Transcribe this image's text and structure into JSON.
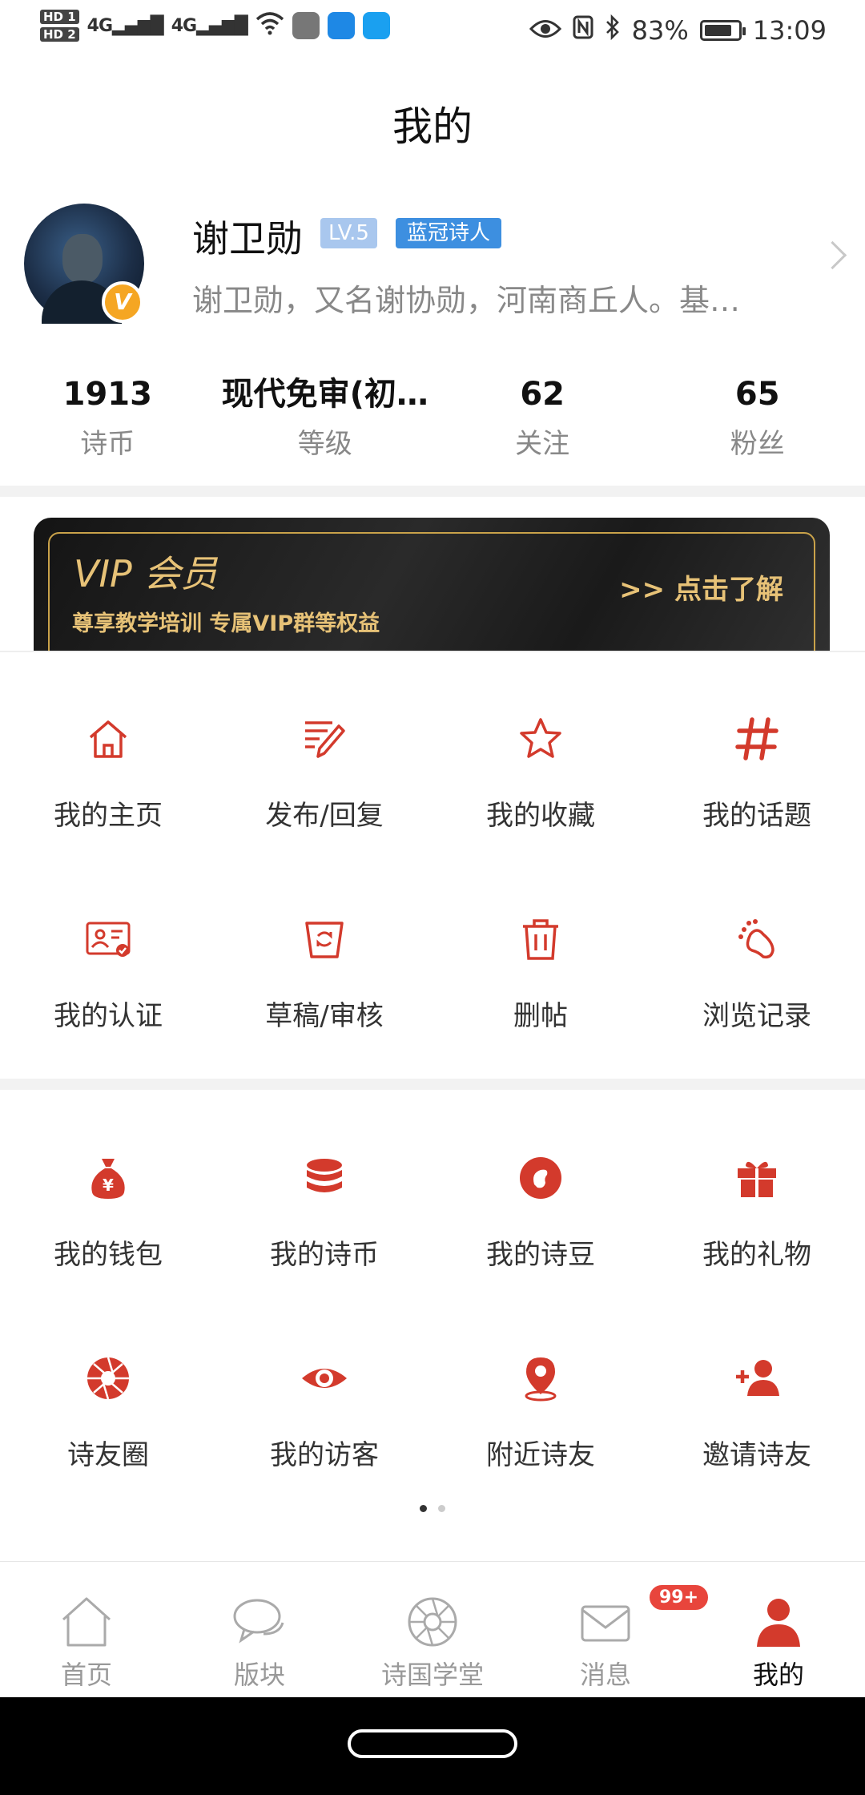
{
  "status_bar": {
    "hd1": "HD 1",
    "hd2": "HD 2",
    "signal1": "4G",
    "signal2": "4G",
    "battery_percent": "83%",
    "battery_level": 0.83,
    "time": "13:09"
  },
  "page": {
    "title": "我的"
  },
  "profile": {
    "name": "谢卫勋",
    "level": "LV.5",
    "title_badge": "蓝冠诗人",
    "bio": "谢卫勋，又名谢协勋，河南商丘人。基…",
    "verified_mark": "V"
  },
  "stats": [
    {
      "value": "1913",
      "label": "诗币"
    },
    {
      "value": "现代免审(初…",
      "label": "等级"
    },
    {
      "value": "62",
      "label": "关注"
    },
    {
      "value": "65",
      "label": "粉丝"
    }
  ],
  "vip": {
    "title": "VIP 会员",
    "subtitle": "尊享教学培训 专属VIP群等权益",
    "cta": ">> 点击了解"
  },
  "menu_primary": [
    {
      "label": "我的主页",
      "icon": "home-icon"
    },
    {
      "label": "发布/回复",
      "icon": "edit-icon"
    },
    {
      "label": "我的收藏",
      "icon": "star-icon"
    },
    {
      "label": "我的话题",
      "icon": "hashtag-icon"
    },
    {
      "label": "我的认证",
      "icon": "id-card-icon"
    },
    {
      "label": "草稿/审核",
      "icon": "draft-icon"
    },
    {
      "label": "删帖",
      "icon": "trash-icon"
    },
    {
      "label": "浏览记录",
      "icon": "footprint-icon"
    }
  ],
  "menu_secondary": [
    {
      "label": "我的钱包",
      "icon": "money-bag-icon"
    },
    {
      "label": "我的诗币",
      "icon": "coins-icon"
    },
    {
      "label": "我的诗豆",
      "icon": "bean-icon"
    },
    {
      "label": "我的礼物",
      "icon": "gift-icon"
    },
    {
      "label": "诗友圈",
      "icon": "aperture-icon"
    },
    {
      "label": "我的访客",
      "icon": "eye-icon"
    },
    {
      "label": "附近诗友",
      "icon": "location-icon"
    },
    {
      "label": "邀请诗友",
      "icon": "add-user-icon"
    }
  ],
  "bottom_nav": [
    {
      "label": "首页",
      "icon": "home-outline-icon"
    },
    {
      "label": "版块",
      "icon": "chat-bubbles-icon"
    },
    {
      "label": "诗国学堂",
      "icon": "aperture-outline-icon"
    },
    {
      "label": "消息",
      "icon": "mail-icon",
      "badge": "99+"
    },
    {
      "label": "我的",
      "icon": "person-icon",
      "active": true
    }
  ],
  "colors": {
    "accent": "#d33a2c",
    "vip_gold": "#e7c277",
    "badge_blue": "#3d8fe0",
    "badge_level": "#a9c7ee",
    "notify_red": "#e8453c"
  }
}
